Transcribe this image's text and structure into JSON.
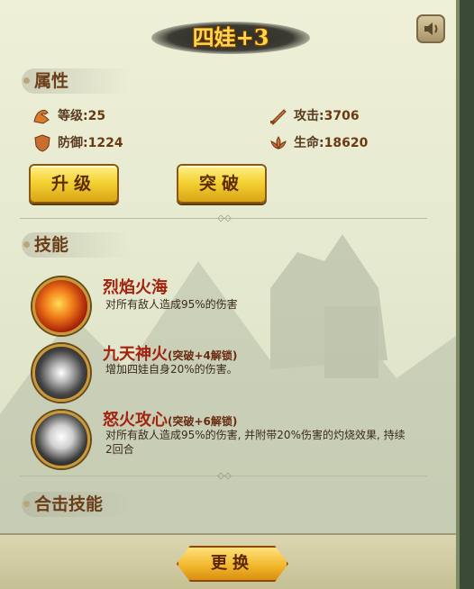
{
  "title": "四娃+3",
  "sections": {
    "attributes": "属性",
    "skills": "技能",
    "combo": "合击技能"
  },
  "stats": {
    "level_label": "等级:",
    "level": "25",
    "defense_label": "防御:",
    "defense": "1224",
    "attack_label": "攻击:",
    "attack": "3706",
    "hp_label": "生命:",
    "hp": "18620"
  },
  "buttons": {
    "upgrade": "升级",
    "breakthrough": "突破",
    "change": "更换"
  },
  "skills": [
    {
      "name": "烈焰火海",
      "tag": "",
      "desc": "对所有敌人造成95%的伤害",
      "icon": "fire-sea-icon"
    },
    {
      "name": "九天神火",
      "tag": "(突破+4解锁)",
      "desc": "增加四娃自身20%的伤害。",
      "icon": "divine-fire-icon"
    },
    {
      "name": "怒火攻心",
      "tag": "(突破+6解锁)",
      "desc": "对所有敌人造成95%的伤害, 并附带20%伤害的灼烧效果, 持续2回合",
      "icon": "rage-fire-icon"
    }
  ],
  "colors": {
    "title": "#ffd84a",
    "skill_name": "#a3230f",
    "section": "#6b3d18"
  }
}
